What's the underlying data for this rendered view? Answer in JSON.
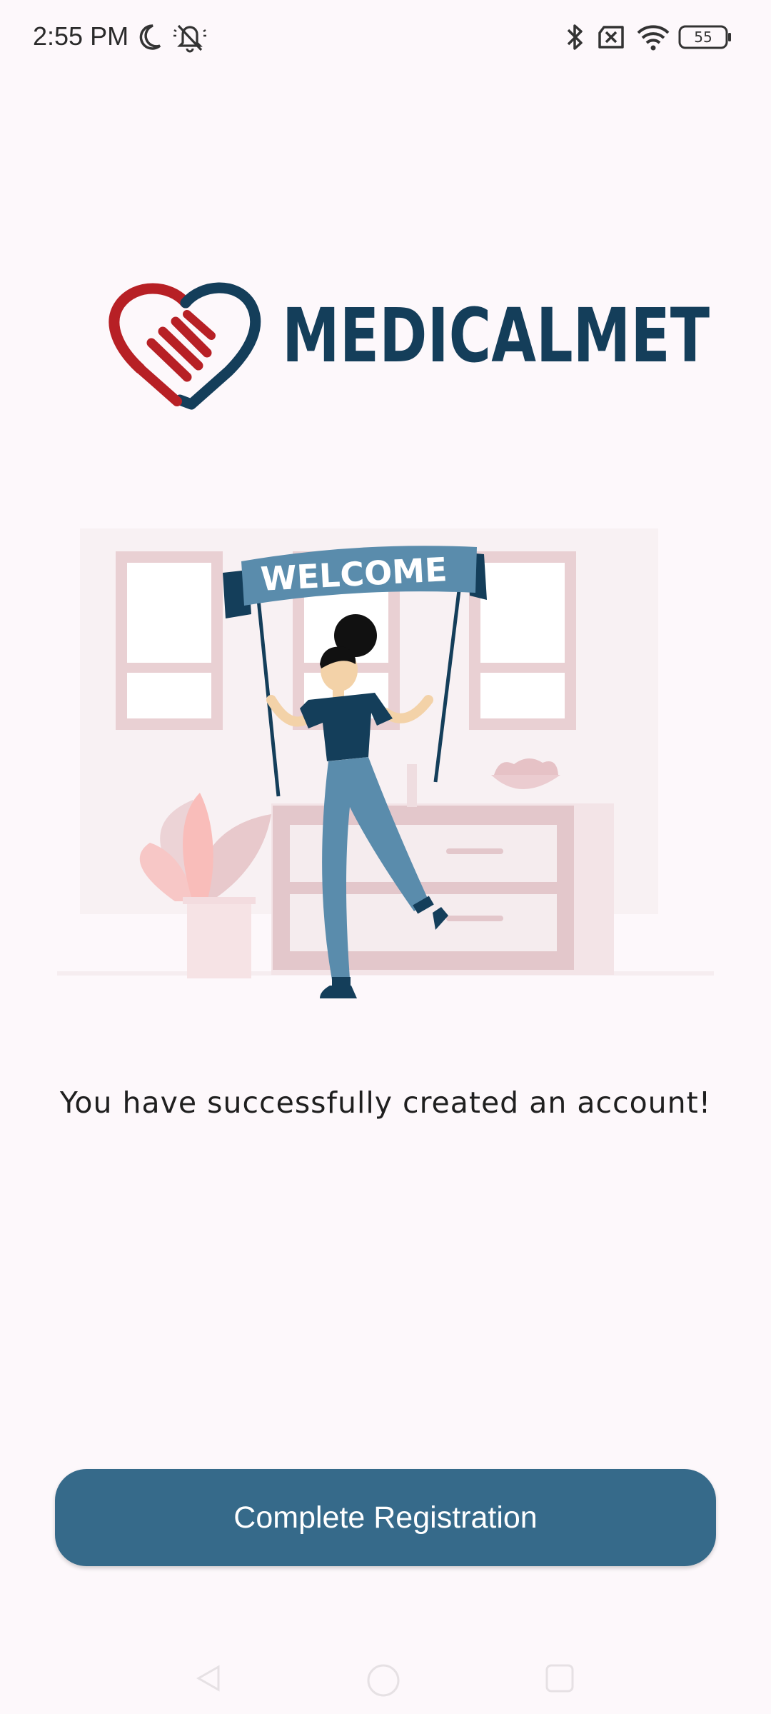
{
  "status_bar": {
    "time": "2:55 PM",
    "battery_level": "55",
    "icons": [
      "moon-icon",
      "bell-off-icon",
      "bluetooth-icon",
      "no-sim-icon",
      "wifi-icon",
      "battery-icon"
    ]
  },
  "logo": {
    "text": "MEDICALMET",
    "colors": {
      "heart_red": "#B72025",
      "heart_navy": "#143E5A"
    }
  },
  "illustration": {
    "banner_text": "WELCOME"
  },
  "message": "You have successfully created an account!",
  "cta": {
    "label": "Complete Registration",
    "color": "#366A8A"
  },
  "nav": {
    "icons": [
      "back-icon",
      "home-icon",
      "recents-icon"
    ]
  }
}
